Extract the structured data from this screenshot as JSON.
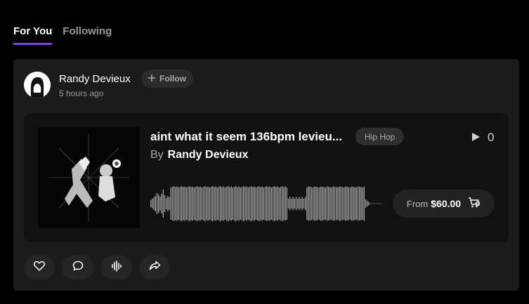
{
  "tabs": [
    {
      "label": "For You",
      "active": true
    },
    {
      "label": "Following",
      "active": false
    }
  ],
  "post": {
    "user_name": "Randy Devieux",
    "time": "5 hours ago",
    "follow_label": "Follow"
  },
  "track": {
    "title": "aint what it seem 136bpm levieu...",
    "genre": "Hip Hop",
    "by_label": "By",
    "artist": "Randy Devieux",
    "play_count": "0",
    "price_from": "From",
    "price": "$60.00"
  },
  "actions": [
    "heart-icon",
    "comment-icon",
    "audio-icon",
    "share-icon"
  ],
  "colors": {
    "accent": "#7b3ff2",
    "card_bg": "#1b1b1b",
    "track_bg": "#111111"
  }
}
